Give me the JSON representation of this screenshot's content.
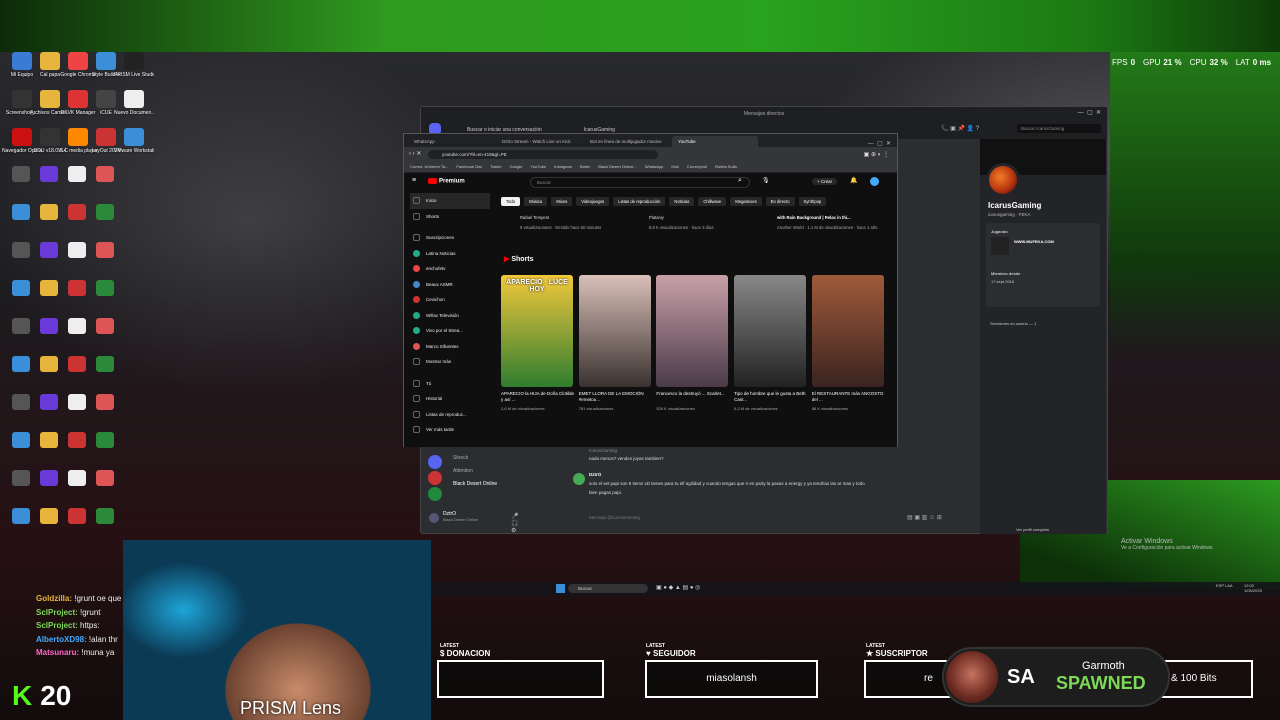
{
  "stats": {
    "fps_label": "FPS",
    "fps": "0",
    "gpu_label": "GPU",
    "gpu": "21 %",
    "cpu_label": "CPU",
    "cpu": "32 %",
    "lat_label": "LAT",
    "lat": "0 ms"
  },
  "desktop_icons": [
    {
      "label": "Mi Equipo",
      "color": "#3a7bd5"
    },
    {
      "label": "Cal papa",
      "color": "#e8b53c"
    },
    {
      "label": "Google Chrome",
      "color": "#e44"
    },
    {
      "label": "Style Builder",
      "color": "#3a8fd8"
    },
    {
      "label": "PRISM Live Studio",
      "color": "#222"
    },
    {
      "label": "Screenshot_...",
      "color": "#333"
    },
    {
      "label": "Archivos Camer...",
      "color": "#e8b53c"
    },
    {
      "label": "DXVK Manager",
      "color": "#d33"
    },
    {
      "label": "iCUE",
      "color": "#444"
    },
    {
      "label": "Nuevo Documen...",
      "color": "#eee"
    },
    {
      "label": "Navegador Opera GX",
      "color": "#c11"
    },
    {
      "label": "DDU v18.0.8.4",
      "color": "#333"
    },
    {
      "label": "VLC media player",
      "color": "#f80"
    },
    {
      "label": "LayOut 2024",
      "color": "#c33"
    },
    {
      "label": "VMware Workstati...",
      "color": "#3a8fd8"
    }
  ],
  "discord": {
    "window_title": "Mensajes directos",
    "search_placeholder": "Buscar o iniciar una conversación",
    "channel": "IcarusGaming",
    "profile_search": "Buscar IcarusGaming",
    "profile_name": "IcarusGaming",
    "profile_handle": "icarusgaming",
    "profile_tag": "FEKA",
    "playing_label": "Jugando",
    "playing_site": "WWW.MUFEKA.COM",
    "member_since_label": "Miembro desde",
    "member_since": "17 sept 2016",
    "common_servers": "Servidores en común — 1",
    "full_profile": "Ver perfil completo",
    "sidebar_items": [
      {
        "label": "Skrock"
      },
      {
        "label": "Attention"
      },
      {
        "label": "Black Desert Online"
      }
    ],
    "user_name": "DztrO",
    "user_status": "Black Desert Online",
    "messages": [
      {
        "author": "IcarusGaming",
        "text": "nada menos? vendes joyas tambien?"
      },
      {
        "author": "DztrO",
        "text": "solo el set papi son 8 items xD tienes para tu elf agilidad y cuando tengas que ir en party la pasas a energy y ya tendrias las ar mas y todo"
      },
      {
        "author": "",
        "text": "bien pagas papi."
      }
    ],
    "message_placeholder": "Mensaje @IcarusGaming"
  },
  "chrome": {
    "tabs": [
      "WhatsApp",
      "Dztro Stream - Watch Live on Kick",
      "Bot en línea de multijugador masivo",
      "YouTube"
    ],
    "url": "youtube.com/?hl=en-419&gl=PE",
    "bookmarks": [
      "Correo: Unbreen Ta...",
      "Facebook Dez",
      "Twitch",
      "Google",
      "YouTube",
      "Instagram",
      "Botrix",
      "Black Desert Online...",
      "WhatsApp",
      "Kick",
      "Crunchyroll",
      "Ruleta Sulla"
    ]
  },
  "youtube": {
    "logo": "Premium",
    "search_placeholder": "Buscar",
    "create": "+ Crear",
    "chips": [
      "Todo",
      "Música",
      "Mixes",
      "Videojuegos",
      "Listas de reproducción",
      "Noticias",
      "Chillwave",
      "Megamixes",
      "En directo",
      "Synthpop"
    ],
    "sidebar": [
      "Inicio",
      "Shorts",
      "Suscripciones",
      "Latina Noticias",
      "enchufetv",
      "Beaux ASMR",
      "Cevichon",
      "Willax Televisión",
      "Vivo por el Strea...",
      "Marco Sifuentes",
      "Mostrar más",
      "Tú",
      "Historial",
      "Listas de reproduc...",
      "Ver más tarde"
    ],
    "top_videos": [
      {
        "channel": "Rafael Tempest",
        "meta": "8 visualizaciones · Emitido hace 50 minutos"
      },
      {
        "channel": "Plataniy",
        "meta": "8,8 K visualizaciones · hace 3 días"
      },
      {
        "channel": "with Rain Background | Relax in thi...",
        "meta": "Another World · 1,1 M de visualizaciones · hace 1 año"
      }
    ],
    "shorts_heading": "Shorts",
    "shorts": [
      {
        "title": "APARECIO la HIJA de Doña Clotilde y así ...",
        "views": "2,6 M de visualizaciones",
        "thumb_text": "APARECIO · LUCE HOY",
        "c1": "#f2c83c",
        "c2": "#2f7d2f"
      },
      {
        "title": "EMET LLORA DE LA EMOCIÓN #emetou...",
        "views": "781 visualizaciones",
        "thumb_text": "",
        "c1": "#d9c0b8",
        "c2": "#3a3230"
      },
      {
        "title": "Francesco la destruyó ... Scarlet...",
        "views": "526 K visualizaciones",
        "thumb_text": "",
        "c1": "#c8a0a8",
        "c2": "#4a3a48"
      },
      {
        "title": "Tipo de hombre que le gusta a Beth Cast...",
        "views": "6,3 M de visualizaciones",
        "thumb_text": "",
        "c1": "#888",
        "c2": "#222"
      },
      {
        "title": "El RESTAURANTE más ANGOSTO del ...",
        "views": "88 K visualizaciones",
        "thumb_text": "",
        "c1": "#a05a3a",
        "c2": "#3a2420"
      }
    ]
  },
  "overlay": {
    "chat": [
      {
        "user": "Goldzilla:",
        "text": "!grunt oe que"
      },
      {
        "user": "SclProject:",
        "text": "!grunt"
      },
      {
        "user": "SclProject:",
        "text": "https:"
      },
      {
        "user": "AlbertoXD98:",
        "text": "!alan thr"
      },
      {
        "user": "Matsunaru:",
        "text": "!muna ya"
      }
    ],
    "kick_count": "20",
    "camera_label": "PRISM Lens",
    "latest_donation_small": "LATEST",
    "latest_donation": "DONACION",
    "donation_value": "",
    "latest_follower_small": "LATEST",
    "latest_follower": "SEGUIDOR",
    "follower_value": "miasolansh",
    "latest_sub_small": "LATEST",
    "latest_sub": "SUSCRIPTOR",
    "sub_value": "re",
    "spawn_short": "SA",
    "spawn_name": "Garmoth",
    "spawn_status": "SPAWNED",
    "bits": "& 100 Bits",
    "activate_title": "Activar Windows",
    "activate_sub": "Ve a Configuración para activar Windows."
  },
  "taskbar": {
    "search": "Buscar",
    "lang": "ESP LAA",
    "time": "12:02",
    "date": "1/05/2025"
  }
}
